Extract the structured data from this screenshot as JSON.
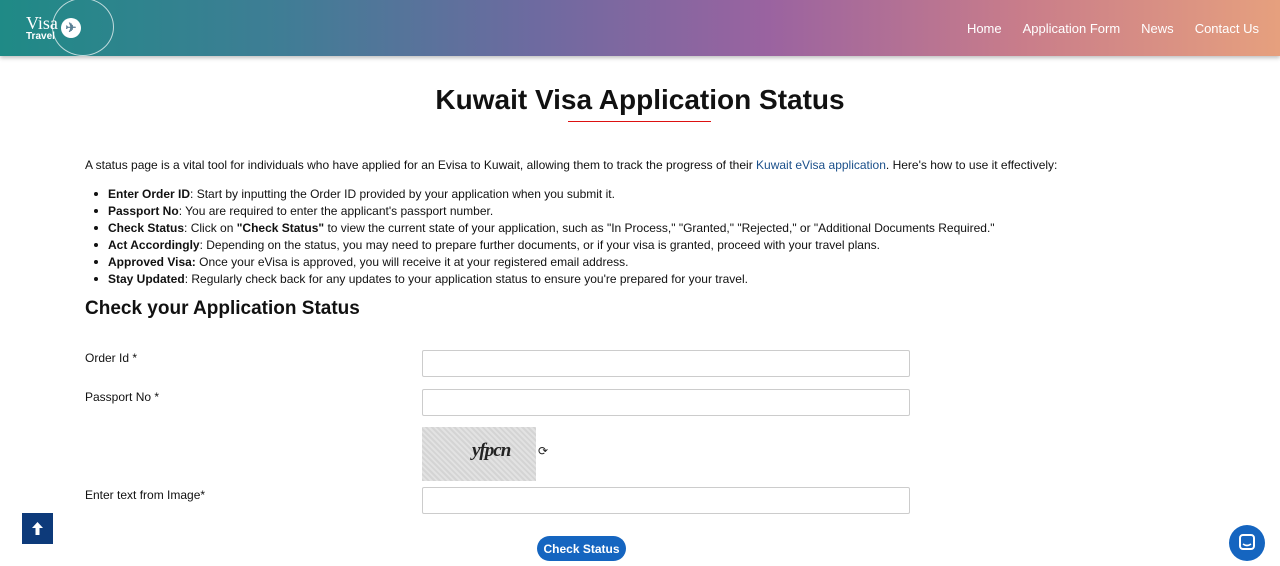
{
  "header": {
    "logo": {
      "top": "Visa",
      "bottom": "Travel"
    },
    "nav": [
      "Home",
      "Application Form",
      "News",
      "Contact Us"
    ]
  },
  "page": {
    "title": "Kuwait Visa Application Status",
    "intro_before": "A status page is a vital tool for individuals who have applied for an Evisa to Kuwait, allowing them to track the progress of their ",
    "intro_link": "Kuwait eVisa application",
    "intro_after": ". Here's how to use it effectively:",
    "steps": [
      {
        "label": "Enter Order ID",
        "text": ": Start by inputting the Order ID provided by your application when you submit it."
      },
      {
        "label": "Passport No",
        "text": ": You are required to enter the applicant's passport number."
      },
      {
        "label": "Check Status",
        "text": ": Click on ",
        "bold2": "\"Check Status\"",
        "text2": " to view the current state of your application, such as \"In Process,\" \"Granted,\" \"Rejected,\" or \"Additional Documents Required.\""
      },
      {
        "label": "Act Accordingly",
        "text": ": Depending on the status, you may need to prepare further documents, or if your visa is granted, proceed with your travel plans."
      },
      {
        "label": "Approved Visa:",
        "text": " Once your eVisa is approved, you will receive it at your registered email address."
      },
      {
        "label": "Stay Updated",
        "text": ": Regularly check back for any updates to your application status to ensure you're prepared for your travel."
      }
    ]
  },
  "form": {
    "heading": "Check your Application Status",
    "order_label": "Order Id *",
    "order_value": "",
    "passport_label": "Passport No *",
    "passport_value": "",
    "captcha_text": "yfpcn",
    "captcha_input_label": "Enter text from Image*",
    "captcha_value": "",
    "submit_label": "Check Status"
  },
  "widgets": {
    "scroll_top_icon": "arrow-up-icon",
    "chat_icon": "chat-icon"
  },
  "colors": {
    "accent": "#1565c0",
    "title_underline": "#dd1111",
    "link": "#1a4f8a",
    "scroll_top_bg": "#0d3a7a"
  }
}
